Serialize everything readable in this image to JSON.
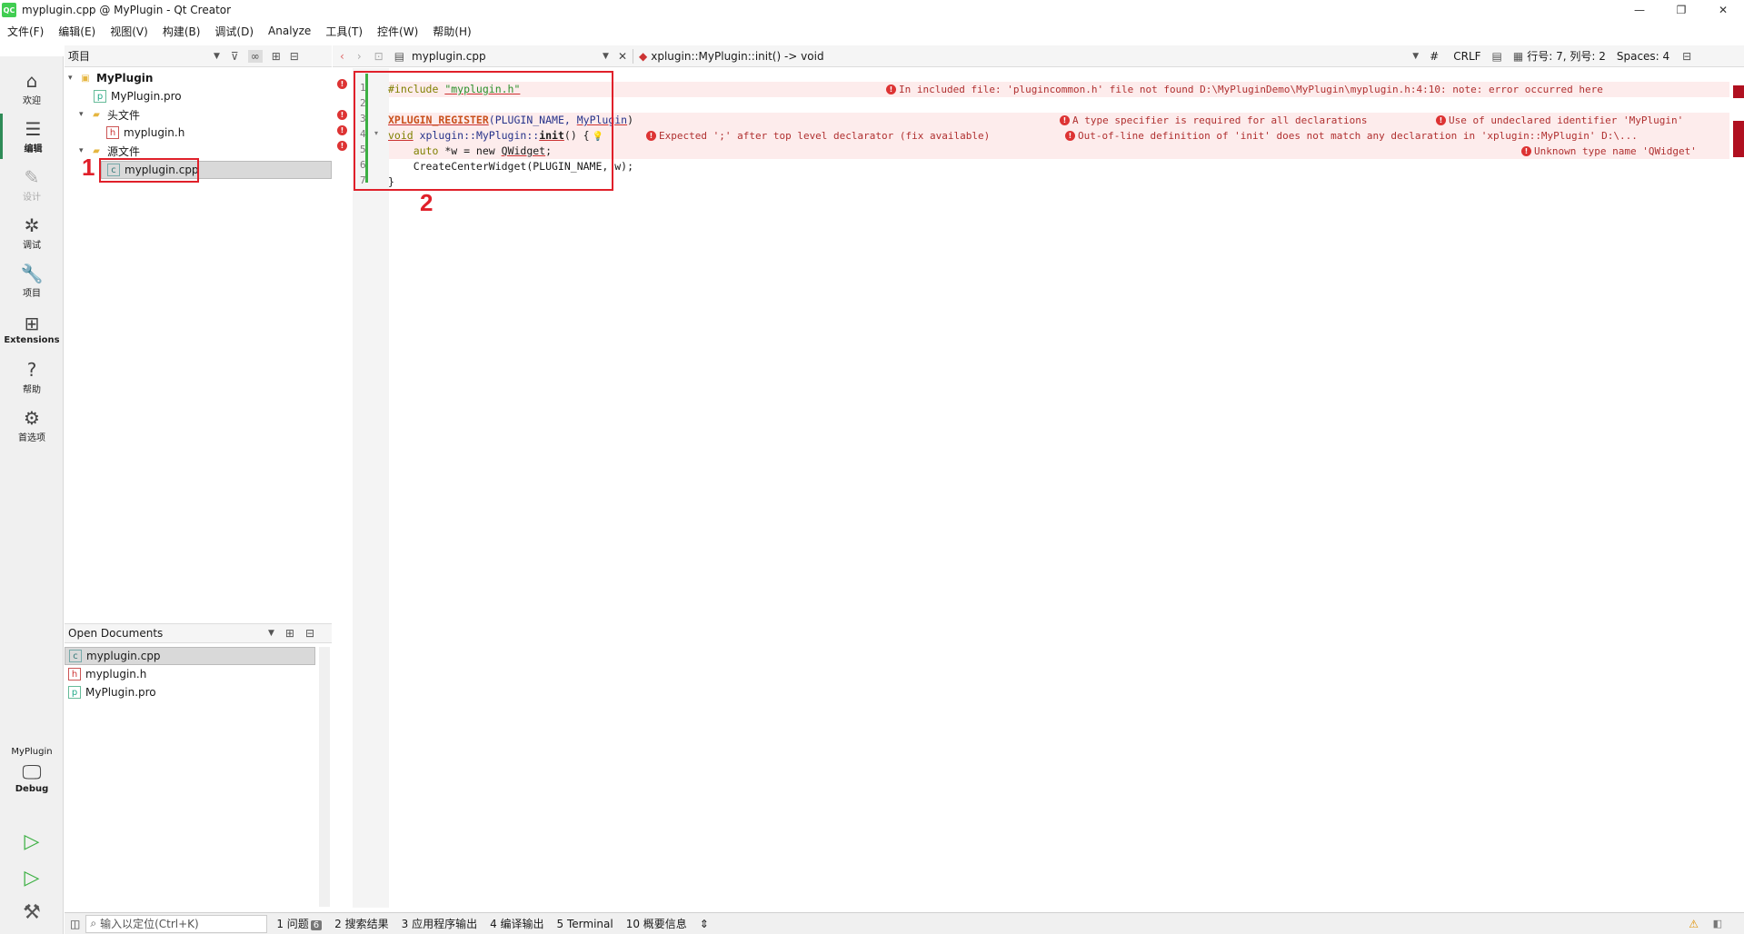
{
  "window": {
    "title": "myplugin.cpp @ MyPlugin - Qt Creator",
    "logo": "QC"
  },
  "menu": [
    "文件(F)",
    "编辑(E)",
    "视图(V)",
    "构建(B)",
    "调试(D)",
    "Analyze",
    "工具(T)",
    "控件(W)",
    "帮助(H)"
  ],
  "modes": [
    {
      "label": "欢迎",
      "icon": "⌂"
    },
    {
      "label": "编辑",
      "icon": "☰"
    },
    {
      "label": "设计",
      "icon": "✎"
    },
    {
      "label": "调试",
      "icon": "✲"
    },
    {
      "label": "项目",
      "icon": "🔧"
    },
    {
      "label": "Extensions",
      "icon": "⊞"
    },
    {
      "label": "帮助",
      "icon": "?"
    },
    {
      "label": "首选项",
      "icon": "⚙"
    }
  ],
  "kit": {
    "project": "MyPlugin",
    "config": "Debug"
  },
  "project_panel": {
    "title": "项目"
  },
  "tree": {
    "root": "MyPlugin",
    "pro_file": "MyPlugin.pro",
    "headers_folder": "头文件",
    "header_file": "myplugin.h",
    "sources_folder": "源文件",
    "source_file": "myplugin.cpp"
  },
  "open_docs": {
    "title": "Open Documents",
    "items": [
      "myplugin.cpp",
      "myplugin.h",
      "MyPlugin.pro"
    ]
  },
  "editor_toolbar": {
    "file": "myplugin.cpp",
    "symbol": "xplugin::MyPlugin::init() -> void",
    "hash": "#",
    "line_ending": "CRLF",
    "position": "行号: 7, 列号: 2",
    "indent": "Spaces: 4"
  },
  "code": {
    "line_numbers": [
      "1",
      "2",
      "3",
      "4",
      "5",
      "6",
      "7"
    ],
    "l1_directive": "#include ",
    "l1_string": "\"myplugin.h\"",
    "l3_macro": "XPLUGIN_REGISTER",
    "l3_args": "(PLUGIN_NAME, ",
    "l3_arg2": "MyPlugin",
    "l3_close": ")",
    "l4_void": "void",
    "l4_scope": " xplugin::MyPlugin::",
    "l4_func": "init",
    "l4_rest": "() {",
    "l5_auto": "    auto",
    "l5_mid": " *w = new ",
    "l5_type": "QWidget",
    "l5_end": ";",
    "l6": "    CreateCenterWidget(PLUGIN_NAME, w);",
    "l7": "}"
  },
  "errors": {
    "e1": "In included file: 'plugincommon.h' file not found D:\\MyPluginDemo\\MyPlugin\\myplugin.h:4:10: note: error occurred here",
    "e2": "A type specifier is required for all declarations",
    "e3": "Use of undeclared identifier 'MyPlugin'",
    "e4": "Expected ';' after top level declarator (fix available)",
    "e5": "Out-of-line definition of 'init' does not match any declaration in 'xplugin::MyPlugin' D:\\...",
    "e6": "Unknown type name 'QWidget'"
  },
  "annotations": {
    "one": "1",
    "two": "2"
  },
  "statusbar": {
    "search_placeholder": "输入以定位(Ctrl+K)",
    "tabs": [
      {
        "label": "1  问题",
        "badge": "6"
      },
      {
        "label": "2  搜索结果"
      },
      {
        "label": "3  应用程序输出"
      },
      {
        "label": "4  编译输出"
      },
      {
        "label": "5  Terminal"
      },
      {
        "label": "10  概要信息"
      }
    ]
  },
  "colors": {
    "accent_green": "#41cd52",
    "error_red": "#d33333",
    "annotation_red": "#e0202a"
  }
}
